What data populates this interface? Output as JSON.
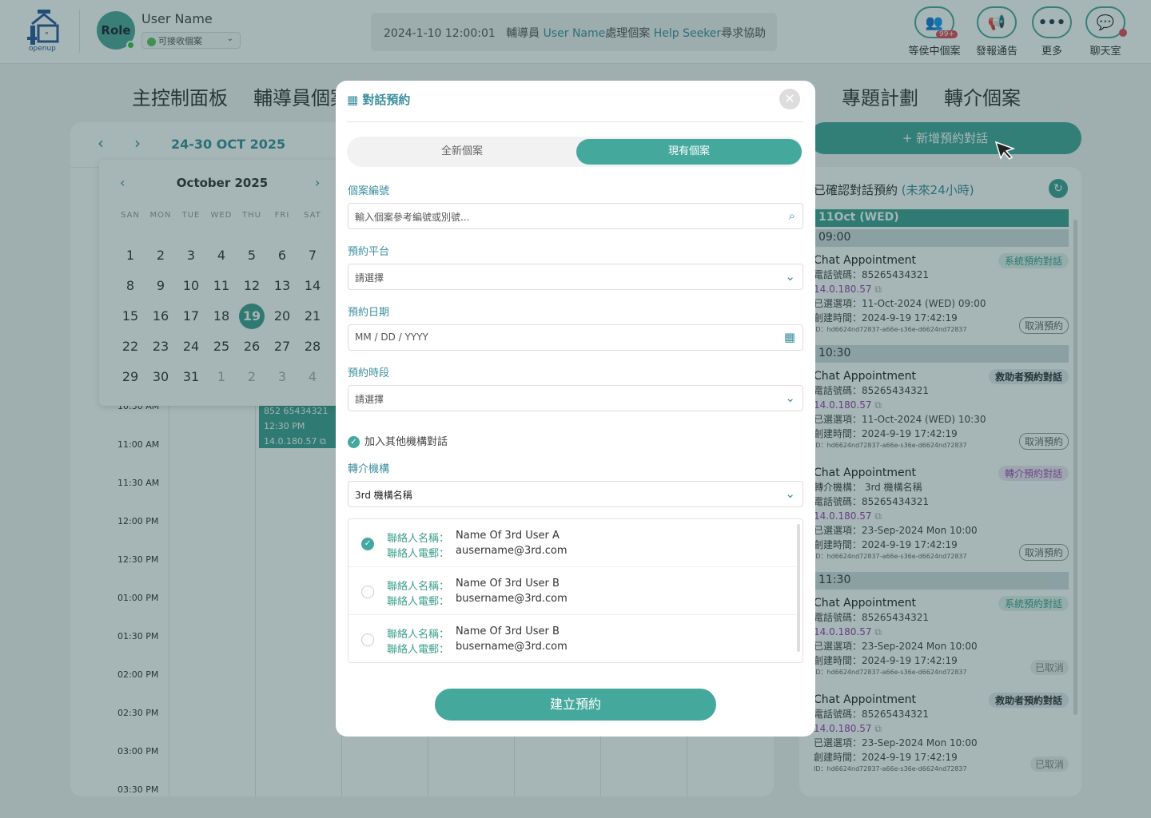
{
  "header": {
    "logo_text": "openup",
    "role_label": "Role",
    "user_name": "User Name",
    "status_label": "可接收個案",
    "notice": {
      "timestamp": "2024-1-10 12:00:01",
      "p1": "輔導員",
      "user": "User Name",
      "p2": "處理個案",
      "seeker": "Help Seeker",
      "p3": "尋求協助"
    },
    "buttons": [
      {
        "label": "等侯中個案",
        "badge": "99+",
        "icon": "waiting-cases-icon"
      },
      {
        "label": "發報通告",
        "icon": "megaphone-icon"
      },
      {
        "label": "更多",
        "icon": "more-icon"
      },
      {
        "label": "聊天室",
        "icon": "chat-room-icon"
      }
    ]
  },
  "nav": {
    "dashboard": "主控制面板",
    "counselor": "輔導員個案",
    "projects": "專題計劃",
    "referrals": "轉介個案"
  },
  "calendar": {
    "range": "24-30 OCT 2025",
    "times": [
      "10:30 AM",
      "11:00 AM",
      "11:30 AM",
      "12:00 PM",
      "12:30 PM",
      "01:00 PM",
      "01:30 PM",
      "02:00 PM",
      "02:30 PM",
      "03:00 PM",
      "03:30 PM"
    ],
    "appt": {
      "phone": "852 65434321",
      "time": "12:30 PM",
      "ip": "14.0.180.57"
    }
  },
  "minical": {
    "title": "October 2025",
    "dow": [
      "SAN",
      "MON",
      "TUE",
      "WED",
      "THU",
      "FRI",
      "SAT"
    ],
    "weeks": [
      [
        "1",
        "2",
        "3",
        "4",
        "5",
        "6",
        "7"
      ],
      [
        "8",
        "9",
        "10",
        "11",
        "12",
        "13",
        "14"
      ],
      [
        "15",
        "16",
        "17",
        "18",
        "19",
        "20",
        "21"
      ],
      [
        "22",
        "23",
        "24",
        "25",
        "26",
        "27",
        "28"
      ],
      [
        "29",
        "30",
        "31",
        "1",
        "2",
        "3",
        "4"
      ]
    ],
    "selected": "19"
  },
  "right": {
    "add_button": "+ 新增預約對話",
    "title": "已確認對話預約",
    "subtitle": "(未來24小時)",
    "day_header": "11Oct (WED)",
    "slots": [
      "09:00",
      "10:30",
      "11:30"
    ],
    "cards": [
      {
        "title": "Chat Appointment",
        "tag": "系統預約對話",
        "phone": "電話號碼：85265434321",
        "ip": "14.0.180.57",
        "selected": "已選選項：11-Oct-2024 (WED) 09:00",
        "created": "創建時間：2024-9-19 17:42:19",
        "id": "ID：hd6624nd72837-a66e-s36e-d6624nd72837",
        "action": "取消預約"
      },
      {
        "title": "Chat Appointment",
        "tag": "救助者預約對話",
        "phone": "電話號碼：85265434321",
        "ip": "14.0.180.57",
        "selected": "已選選項：11-Oct-2024 (WED) 10:30",
        "created": "創建時間：2024-9-19 17:42:19",
        "id": "ID：hd6624nd72837-a66e-s36e-d6624nd72837",
        "action": "取消預約"
      },
      {
        "title": "Chat Appointment",
        "tag": "轉介預約對話",
        "referral": "轉介機構： 3rd 機構名稱",
        "phone": "電話號碼：85265434321",
        "ip": "14.0.180.57",
        "selected": "已選選項：23-Sep-2024 Mon 10:00",
        "created": "創建時間：2024-9-19 17:42:19",
        "id": "ID：hd6624nd72837-a66e-s36e-d6624nd72837",
        "action": "取消預約"
      },
      {
        "title": "Chat Appointment",
        "tag": "系統預約對話",
        "phone": "電話號碼：85265434321",
        "ip": "14.0.180.57",
        "selected": "已選選項：23-Sep-2024 Mon 10:00",
        "created": "創建時間：2024-9-19 17:42:19",
        "id": "ID：hd6624nd72837-a66e-s36e-d6624nd72837",
        "action": "已取消"
      },
      {
        "title": "Chat Appointment",
        "tag": "救助者預約對話",
        "phone": "電話號碼：85265434321",
        "ip": "14.0.180.57",
        "selected": "已選選項：23-Sep-2024 Mon 10:00",
        "created": "創建時間：2024-9-19 17:42:19",
        "id": "ID：hd6624nd72837-a66e-s36e-d6624nd72837",
        "action": "已取消"
      }
    ]
  },
  "modal": {
    "title": "對話預約",
    "tabs": [
      "全新個案",
      "現有個案"
    ],
    "case_label": "個案編號",
    "case_placeholder": "輸入個案參考編號或別號...",
    "platform_label": "預約平台",
    "platform_value": "請選擇",
    "date_label": "預約日期",
    "date_placeholder": "MM / DD / YYYY",
    "slot_label": "預約時段",
    "slot_value": "請選擇",
    "other_org": "加入其他機構對話",
    "org_label": "轉介機構",
    "org_value": "3rd 機構名稱",
    "contact_name_label": "聯絡人名稱：",
    "contact_email_label": "聯絡人電郵：",
    "contacts": [
      {
        "name": "Name Of 3rd User A",
        "email": "ausername@3rd.com",
        "checked": true
      },
      {
        "name": "Name Of 3rd User B",
        "email": "busername@3rd.com",
        "checked": false
      },
      {
        "name": "Name Of 3rd User B",
        "email": "busername@3rd.com",
        "checked": false
      }
    ],
    "submit": "建立預約"
  },
  "colors": {
    "accent": "#45a89d",
    "link": "#3c8fa0",
    "ip": "#9b3fb0",
    "danger": "#e24b5b"
  }
}
